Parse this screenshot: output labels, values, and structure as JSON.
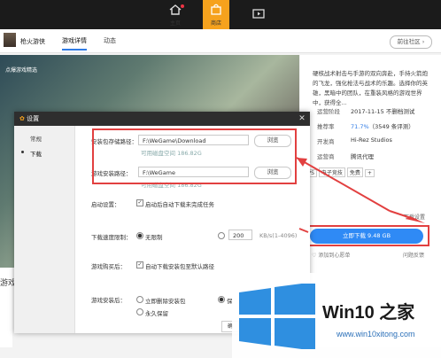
{
  "topbar": {
    "items": [
      {
        "label": "主页",
        "icon": "home-icon"
      },
      {
        "label": "商店",
        "icon": "shopping-bag-icon"
      },
      {
        "label": "",
        "icon": "video-icon"
      }
    ]
  },
  "game_header": {
    "game_name": "枪火游侠",
    "tabs": [
      "游戏详情",
      "动态"
    ],
    "goto_community": "前往社区"
  },
  "banner": {
    "tag": "点爆游戏精选"
  },
  "right_panel": {
    "description": "硬核战术射击与手游的双向奔赴，手持火箭炮的飞龙，强化枪法与战术的乐趣。选择你的英雄，黑暗中的团队，在重装风格的游戏世界中，获得全...",
    "info": [
      {
        "key": "运营阶段",
        "value": "2017-11-15 不删档测试"
      },
      {
        "key": "推荐率",
        "value": "71.7%（3549 条评测）"
      },
      {
        "key": "开发商",
        "value": "Hi-Rez Studios"
      },
      {
        "key": "运营商",
        "value": "腾讯代理"
      }
    ],
    "tags": [
      "FPS",
      "电子竞技",
      "免费"
    ],
    "download_settings": "下载设置",
    "download_button": "立即下载  9.48 GB",
    "favorite": "添加到心愿单",
    "feedback": "问题反馈"
  },
  "left_strip_text": "游戏",
  "settings_dialog": {
    "title": "设置",
    "sidebar": [
      {
        "label": "常规",
        "active": false
      },
      {
        "label": "下载",
        "active": true
      }
    ],
    "install_pkg_label": "安装包存储路径：",
    "install_pkg_path": "F:\\WeGame\\Download",
    "install_pkg_space": "可用磁盘空间 186.82G",
    "game_path_label": "游戏安装路径：",
    "game_path": "F:\\WeGame",
    "game_path_space": "可用磁盘空间 186.82G",
    "browse": "浏览",
    "autostart_label": "启动设置：",
    "autostart_option": "启动后自动下载未完成任务",
    "speed_label": "下载速度限制：",
    "speed_unlimited": "无限制",
    "speed_value": "200",
    "speed_unit": "KB/s(1-4096)",
    "after_buy_label": "游戏购买后：",
    "after_buy_option": "自动下载安装包至默认路径",
    "after_install_label": "游戏安装后：",
    "after_install_delete": "立即删除安装包",
    "after_install_keep": "永久保留",
    "after_install_other": "保",
    "ok_button": "确"
  },
  "watermark": {
    "title": "Win10 之家",
    "url": "www.win10xitong.com"
  },
  "colors": {
    "accent": "#2f8af5",
    "topbar": "#1b1b1b",
    "store_active": "#f6a21d",
    "highlight": "#e24040"
  }
}
